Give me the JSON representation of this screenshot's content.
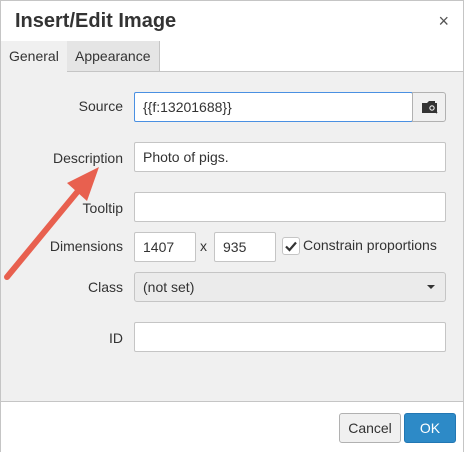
{
  "dialog": {
    "title": "Insert/Edit Image",
    "close_icon": "×"
  },
  "tabs": [
    {
      "label": "General",
      "active": true
    },
    {
      "label": "Appearance",
      "active": false
    }
  ],
  "form": {
    "source": {
      "label": "Source",
      "value": "{{f:13201688}}",
      "browse_icon": "browse-image-icon"
    },
    "description": {
      "label": "Description",
      "value": "Photo of pigs."
    },
    "tooltip": {
      "label": "Tooltip",
      "value": ""
    },
    "dimensions": {
      "label": "Dimensions",
      "width": "1407",
      "separator": "x",
      "height": "935",
      "constrain_label": "Constrain proportions",
      "constrain_checked": true
    },
    "class": {
      "label": "Class",
      "selected": "(not set)"
    },
    "id": {
      "label": "ID",
      "value": ""
    }
  },
  "footer": {
    "cancel_label": "Cancel",
    "ok_label": "OK"
  },
  "annotation": {
    "arrow_color": "#e8604f"
  },
  "colors": {
    "accent": "#2d8ac7",
    "focus_border": "#4a90e2"
  }
}
